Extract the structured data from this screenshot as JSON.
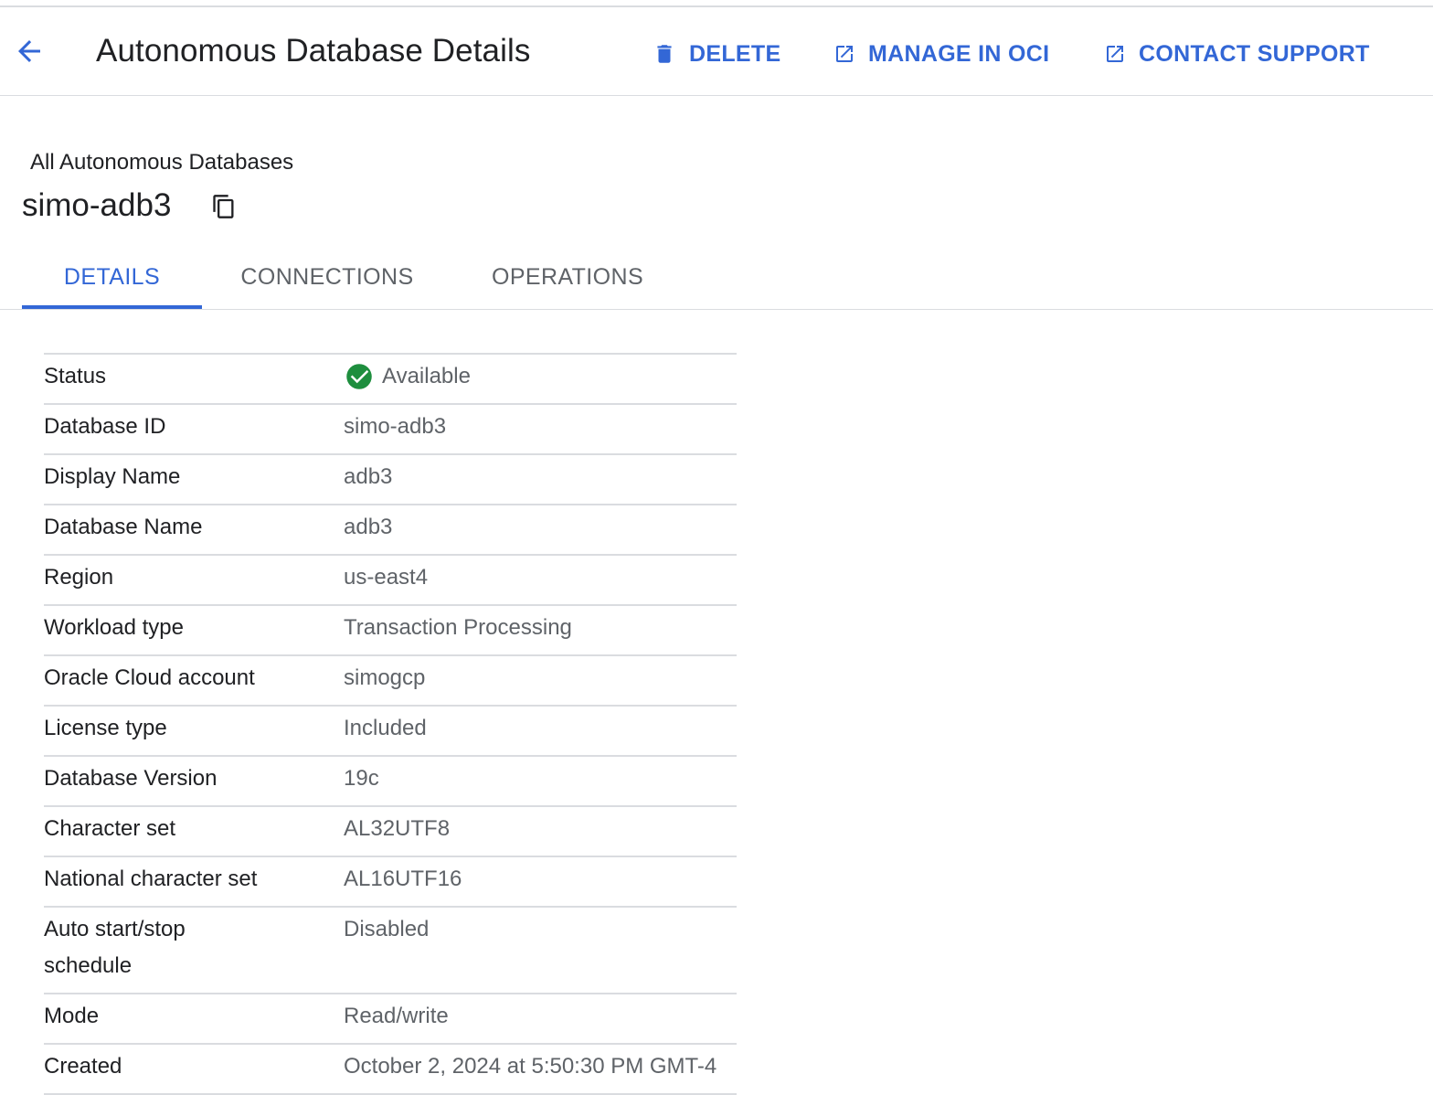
{
  "header": {
    "title": "Autonomous Database Details",
    "actions": {
      "delete": "DELETE",
      "manage": "MANAGE IN OCI",
      "support": "CONTACT SUPPORT"
    }
  },
  "breadcrumb": "All Autonomous Databases",
  "resource_name": "simo-adb3",
  "tabs": [
    {
      "label": "DETAILS",
      "active": true
    },
    {
      "label": "CONNECTIONS",
      "active": false
    },
    {
      "label": "OPERATIONS",
      "active": false
    }
  ],
  "details": [
    {
      "key": "Status",
      "value": "Available",
      "icon": "check-circle-icon"
    },
    {
      "key": "Database ID",
      "value": "simo-adb3"
    },
    {
      "key": "Display Name",
      "value": "adb3"
    },
    {
      "key": "Database Name",
      "value": "adb3"
    },
    {
      "key": "Region",
      "value": "us-east4"
    },
    {
      "key": "Workload type",
      "value": "Transaction Processing"
    },
    {
      "key": "Oracle Cloud account",
      "value": "simogcp"
    },
    {
      "key": "License type",
      "value": "Included"
    },
    {
      "key": "Database Version",
      "value": "19c"
    },
    {
      "key": "Character set",
      "value": "AL32UTF8"
    },
    {
      "key": "National character set",
      "value": "AL16UTF16"
    },
    {
      "key": "Auto start/stop\nschedule",
      "value": "Disabled"
    },
    {
      "key": "Mode",
      "value": "Read/write"
    },
    {
      "key": "Created",
      "value": "October 2, 2024 at 5:50:30 PM GMT-4"
    }
  ],
  "colors": {
    "accent": "#3367d6",
    "status_ok": "#1e8e3e",
    "divider": "#dadce0"
  }
}
